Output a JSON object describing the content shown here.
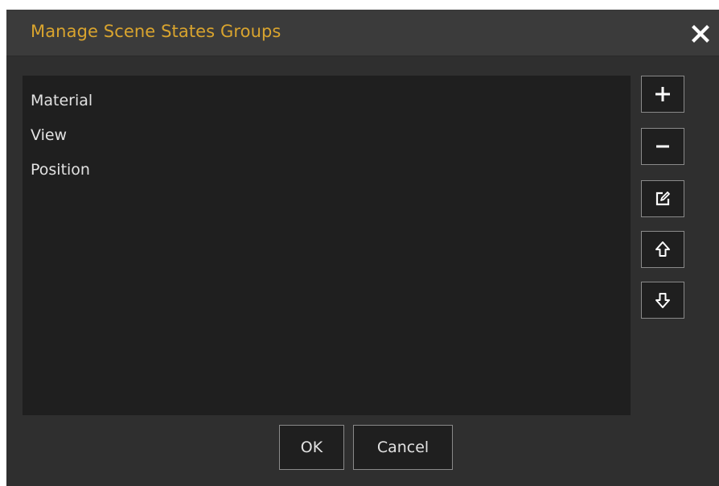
{
  "dialog": {
    "title": "Manage Scene States Groups",
    "title_color": "#d9a42e",
    "close_icon": "close-icon"
  },
  "groups": {
    "items": [
      {
        "label": "Material"
      },
      {
        "label": "View"
      },
      {
        "label": "Position"
      }
    ]
  },
  "side_buttons": [
    {
      "name": "add-group-button",
      "icon": "plus-icon"
    },
    {
      "name": "remove-group-button",
      "icon": "minus-icon"
    },
    {
      "name": "edit-group-button",
      "icon": "edit-icon"
    },
    {
      "name": "move-up-button",
      "icon": "arrow-up-icon"
    },
    {
      "name": "move-down-button",
      "icon": "arrow-down-icon"
    }
  ],
  "footer": {
    "ok_label": "OK",
    "cancel_label": "Cancel"
  }
}
